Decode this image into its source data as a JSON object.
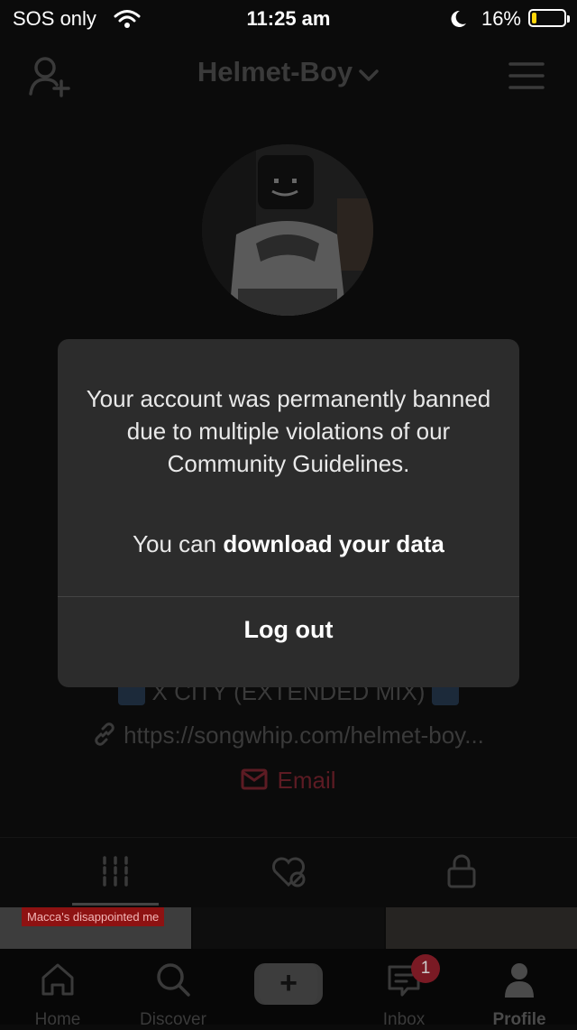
{
  "status_bar": {
    "carrier": "SOS only",
    "time": "11:25 am",
    "battery": "16%",
    "battery_level": 0.16
  },
  "header": {
    "username": "Helmet-Boy"
  },
  "profile": {
    "bio_line": "X CITY (EXTENDED MIX)",
    "link": "https://songwhip.com/helmet-boy...",
    "email": "Email"
  },
  "thumbnail_caption": "Macca's disappointed me",
  "modal": {
    "message": "Your account was permanently banned due to multiple violations of our Community Guidelines.",
    "sub_prefix": "You can ",
    "sub_link": "download your data",
    "logout": "Log out"
  },
  "bottom_nav": {
    "home": "Home",
    "discover": "Discover",
    "plus": "+",
    "inbox": "Inbox",
    "inbox_badge": "1",
    "profile": "Profile"
  },
  "colors": {
    "modal_bg": "#2c2c2c",
    "battery_fill": "#ffd60a",
    "badge": "#7a1a24"
  }
}
